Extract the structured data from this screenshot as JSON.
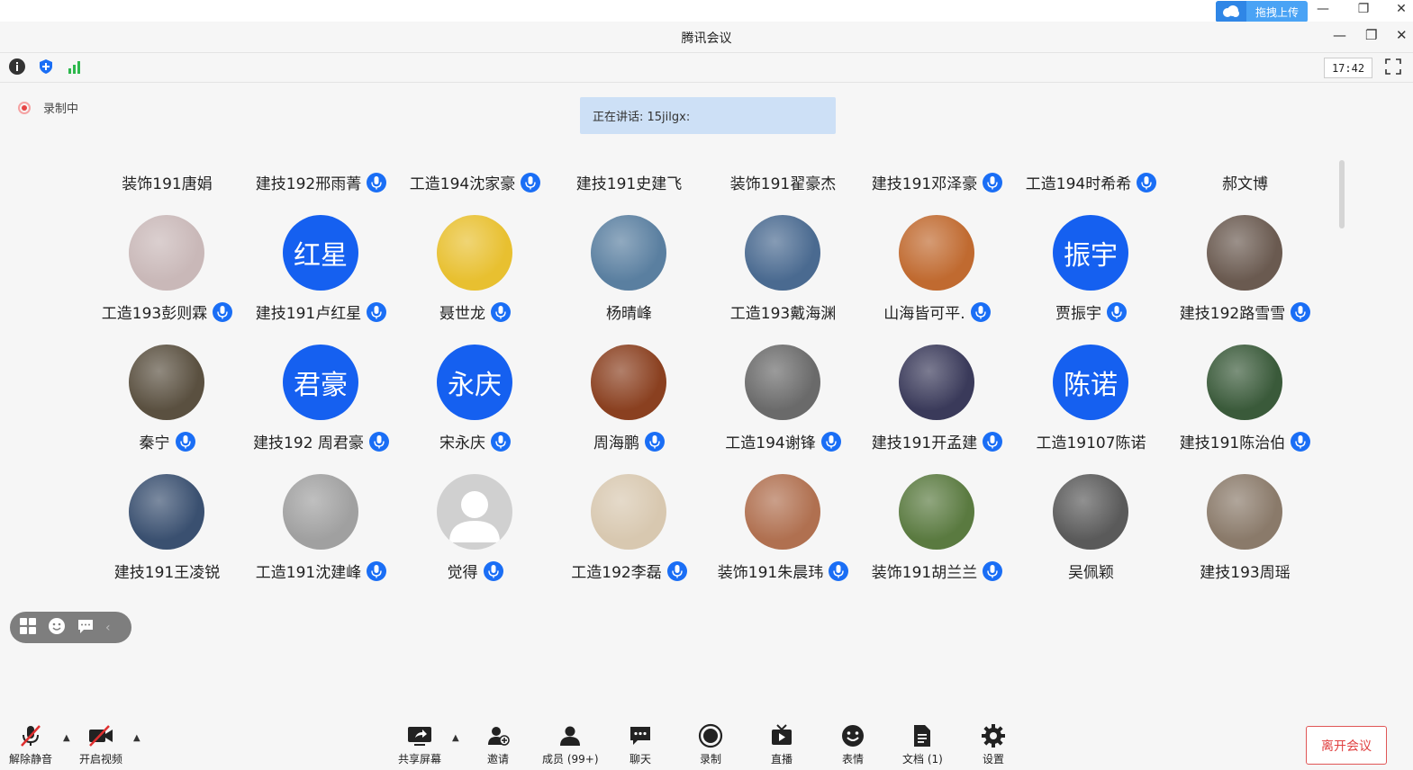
{
  "window": {
    "title": "腾讯会议",
    "upload_label": "拖拽上传"
  },
  "toolbar": {
    "clock": "17:42"
  },
  "recording": {
    "label": "录制中"
  },
  "speaking": {
    "text": "正在讲话: 15jilgx:"
  },
  "participants": [
    {
      "name": "装饰191唐娟",
      "avatar": "none",
      "mic": false
    },
    {
      "name": "建技192邢雨菁",
      "avatar": "none",
      "mic": true
    },
    {
      "name": "工造194沈家豪",
      "avatar": "none",
      "mic": true
    },
    {
      "name": "建技191史建飞",
      "avatar": "none",
      "mic": false
    },
    {
      "name": "装饰191翟豪杰",
      "avatar": "none",
      "mic": false
    },
    {
      "name": "建技191邓泽豪",
      "avatar": "none",
      "mic": true
    },
    {
      "name": "工造194时希希",
      "avatar": "none",
      "mic": true
    },
    {
      "name": "郝文博",
      "avatar": "none",
      "mic": false
    },
    {
      "name": "工造193彭则霖",
      "avatar": "photo",
      "color": "#c9b8b8",
      "mic": true
    },
    {
      "name": "建技191卢红星",
      "avatar": "text",
      "avatar_text": "红星",
      "mic": true
    },
    {
      "name": "聂世龙",
      "avatar": "photo",
      "color": "#e8c030",
      "mic": true
    },
    {
      "name": "杨晴峰",
      "avatar": "photo",
      "color": "#5a7fa0",
      "mic": false
    },
    {
      "name": "工造193戴海渊",
      "avatar": "photo",
      "color": "#4a6a90",
      "mic": false
    },
    {
      "name": "山海皆可平.",
      "avatar": "photo",
      "color": "#c06a30",
      "mic": true
    },
    {
      "name": "贾振宇",
      "avatar": "text",
      "avatar_text": "振宇",
      "mic": true
    },
    {
      "name": "建技192路雪雪",
      "avatar": "photo",
      "color": "#6a5a50",
      "mic": true
    },
    {
      "name": "秦宁",
      "avatar": "photo",
      "color": "#5a5040",
      "mic": true
    },
    {
      "name": "建技192 周君豪",
      "avatar": "text",
      "avatar_text": "君豪",
      "mic": true
    },
    {
      "name": "宋永庆",
      "avatar": "text",
      "avatar_text": "永庆",
      "mic": true
    },
    {
      "name": "周海鹏",
      "avatar": "photo",
      "color": "#8a4020",
      "mic": true
    },
    {
      "name": "工造194谢锋",
      "avatar": "photo",
      "color": "#6a6a6a",
      "mic": true
    },
    {
      "name": "建技191开孟建",
      "avatar": "photo",
      "color": "#3a3a5a",
      "mic": true
    },
    {
      "name": "工造19107陈诺",
      "avatar": "text",
      "avatar_text": "陈诺",
      "mic": false
    },
    {
      "name": "建技191陈治伯",
      "avatar": "photo",
      "color": "#3a5a3a",
      "mic": true
    },
    {
      "name": "建技191王凌锐",
      "avatar": "photo",
      "color": "#3a5070",
      "mic": false
    },
    {
      "name": "工造191沈建峰",
      "avatar": "photo",
      "color": "#a0a0a0",
      "mic": true
    },
    {
      "name": "觉得",
      "avatar": "default",
      "color": "#d0d0d0",
      "mic": true
    },
    {
      "name": "工造192李磊",
      "avatar": "photo",
      "color": "#d8c8b0",
      "mic": true
    },
    {
      "name": "装饰191朱晨玮",
      "avatar": "photo",
      "color": "#b07050",
      "mic": true
    },
    {
      "name": "装饰191胡兰兰",
      "avatar": "photo",
      "color": "#5a7a40",
      "mic": true
    },
    {
      "name": "吴佩颖",
      "avatar": "photo",
      "color": "#5a5a5a",
      "mic": false
    },
    {
      "name": "建技193周瑶",
      "avatar": "photo",
      "color": "#8a7a6a",
      "mic": false
    }
  ],
  "bottom_bar": {
    "unmute": "解除静音",
    "video": "开启视频",
    "share": "共享屏幕",
    "invite": "邀请",
    "members": "成员 (99+)",
    "chat": "聊天",
    "record": "录制",
    "live": "直播",
    "emoji": "表情",
    "docs": "文档 (1)",
    "settings": "设置",
    "leave": "离开会议"
  },
  "colors": {
    "accent": "#1560f0",
    "mic": "#1a6ef5",
    "leave": "#e04040"
  }
}
